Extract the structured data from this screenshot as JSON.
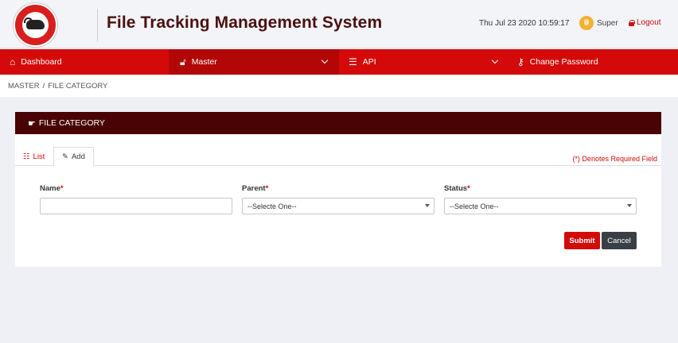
{
  "header": {
    "title": "File Tracking Management System",
    "datetime": "Thu Jul 23 2020 10:59:17",
    "user_name": "Super",
    "logout_label": "Logout",
    "logo_icon": "emblem-logo"
  },
  "nav": {
    "items": [
      {
        "label": "Dashboard",
        "icon": "home-icon"
      },
      {
        "label": "Master",
        "icon": "lock-icon",
        "active": true
      },
      {
        "label": "API",
        "icon": "server-icon"
      },
      {
        "label": "Change Password",
        "icon": "key-icon"
      }
    ]
  },
  "breadcrumb": {
    "root": "MASTER",
    "separator": "/",
    "current": "FILE CATEGORY"
  },
  "card": {
    "title": "FILE CATEGORY",
    "tabs": [
      {
        "label": "List",
        "icon": "list-icon"
      },
      {
        "label": "Add",
        "icon": "edit-icon",
        "active": true
      }
    ],
    "required_note": "(*) Denotes Required Field",
    "fields": {
      "name_label": "Name",
      "name_value": "",
      "parent_label": "Parent",
      "parent_value": "--Selecte One--",
      "status_label": "Status",
      "status_value": "--Selecte One--",
      "required_mark": "*"
    },
    "buttons": {
      "submit": "Submit",
      "cancel": "Cancel"
    }
  },
  "colors": {
    "nav_bg": "#d40a0a",
    "card_header_bg": "#4a0304",
    "title_color": "#4a1010",
    "required_color": "#d40a0a"
  }
}
